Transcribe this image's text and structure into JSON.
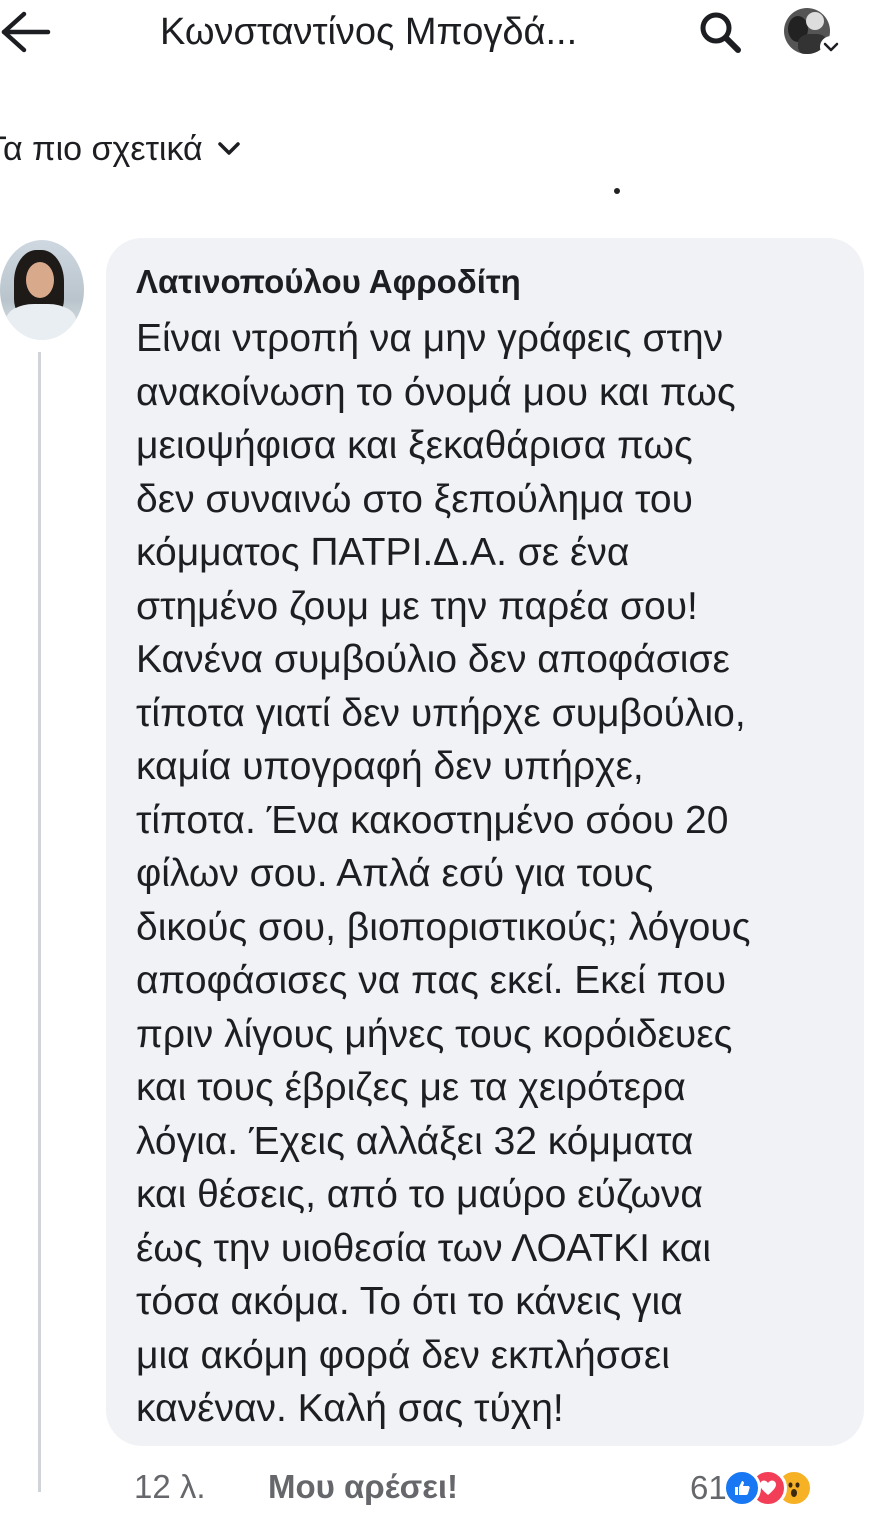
{
  "header": {
    "back_icon": "arrow-left-icon",
    "title": "Κωνσταντίνος Μπογδά...",
    "search_icon": "search-icon",
    "profile_icon": "profile-avatar",
    "profile_chevron_icon": "chevron-down-icon"
  },
  "filter": {
    "label": "Τα πιο σχετικά",
    "chevron_icon": "chevron-down-icon"
  },
  "comment": {
    "author": "Λατινοπούλου Αφροδίτη",
    "lines": [
      "Είναι ντροπή να μην γράφεις στην",
      "ανακοίνωση το όνομά μου και πως",
      "μειοψήφισα και ξεκαθάρισα πως",
      "δεν συναινώ στο ξεπούλημα του",
      "κόμματος ΠΑΤΡΙ.Δ.Α. σε ένα",
      "στημένο ζουμ με την παρέα σου!",
      "Κανένα συμβούλιο δεν αποφάσισε",
      "τίποτα γιατί δεν υπήρχε συμβούλιο,",
      "καμία υπογραφή δεν υπήρχε,",
      "τίποτα. Ένα κακοστημένο σόου 20",
      "φίλων σου. Απλά εσύ για τους",
      "δικούς σου, βιοποριστικούς; λόγους",
      "αποφάσισες να πας εκεί. Εκεί που",
      "πριν λίγους μήνες τους κορόιδευες",
      "και τους έβριζες με τα χειρότερα",
      "λόγια. Έχεις αλλάξει 32 κόμματα",
      "και θέσεις, από το μαύρο εύζωνα",
      "έως την υιοθεσία των ΛΟΑΤΚΙ και",
      "τόσα ακόμα.  Το ότι το κάνεις για",
      "μια ακόμη φορά δεν εκπλήσσει",
      "κανέναν. Καλή σας τύχη!"
    ],
    "time": "12 λ.",
    "like_label": "Μου αρέσει!",
    "reaction_count": "61",
    "reactions": [
      "like-icon",
      "love-icon",
      "wow-icon"
    ]
  },
  "colors": {
    "bubble_bg": "#f0f2f5",
    "text": "#1c1e21",
    "muted": "#65676b",
    "like_blue": "#1877f2",
    "love_red": "#f33e58",
    "wow_yellow": "#f7b125"
  }
}
